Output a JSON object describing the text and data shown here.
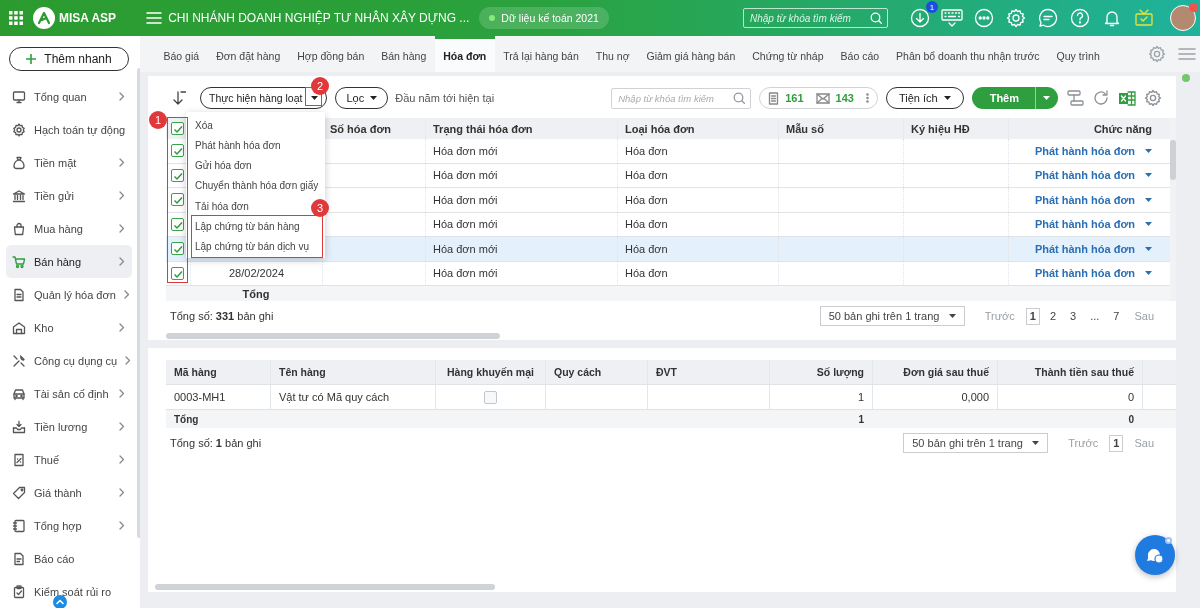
{
  "header": {
    "logo": "MISA ASP",
    "company": "CHI NHÁNH DOANH NGHIỆP TƯ NHÂN XÂY DỰNG ...",
    "dataset": "Dữ liệu kế toán 2021",
    "search_placeholder": "Nhập từ khóa tìm kiếm",
    "download_badge": "1"
  },
  "sidebar": {
    "quick_add": "Thêm nhanh",
    "items": [
      {
        "label": "Tổng quan",
        "selected": false,
        "has_submenu": true
      },
      {
        "label": "Hạch toán tự động",
        "selected": false,
        "has_submenu": false
      },
      {
        "label": "Tiền mặt",
        "selected": false,
        "has_submenu": true
      },
      {
        "label": "Tiền gửi",
        "selected": false,
        "has_submenu": true
      },
      {
        "label": "Mua hàng",
        "selected": false,
        "has_submenu": true
      },
      {
        "label": "Bán hàng",
        "selected": true,
        "has_submenu": true
      },
      {
        "label": "Quản lý hóa đơn",
        "selected": false,
        "has_submenu": true
      },
      {
        "label": "Kho",
        "selected": false,
        "has_submenu": true
      },
      {
        "label": "Công cụ dụng cụ",
        "selected": false,
        "has_submenu": true
      },
      {
        "label": "Tài sản cố định",
        "selected": false,
        "has_submenu": true
      },
      {
        "label": "Tiền lương",
        "selected": false,
        "has_submenu": true
      },
      {
        "label": "Thuế",
        "selected": false,
        "has_submenu": true
      },
      {
        "label": "Giá thành",
        "selected": false,
        "has_submenu": true
      },
      {
        "label": "Tổng hợp",
        "selected": false,
        "has_submenu": true
      },
      {
        "label": "Báo cáo",
        "selected": false,
        "has_submenu": false
      },
      {
        "label": "Kiểm soát rủi ro",
        "selected": false,
        "has_submenu": false
      }
    ]
  },
  "tabs": [
    {
      "label": "Báo giá",
      "selected": false
    },
    {
      "label": "Đơn đặt hàng",
      "selected": false
    },
    {
      "label": "Hợp đồng bán",
      "selected": false
    },
    {
      "label": "Bán hàng",
      "selected": false
    },
    {
      "label": "Hóa đơn",
      "selected": true
    },
    {
      "label": "Trả lại hàng bán",
      "selected": false
    },
    {
      "label": "Thu nợ",
      "selected": false
    },
    {
      "label": "Giảm giá hàng bán",
      "selected": false
    },
    {
      "label": "Chứng từ nháp",
      "selected": false
    },
    {
      "label": "Báo cáo",
      "selected": false
    },
    {
      "label": "Phân bổ doanh thu nhận trước",
      "selected": false
    },
    {
      "label": "Quy trình",
      "selected": false
    }
  ],
  "toolbar": {
    "batch": "Thực hiện hàng loạt",
    "filter": "Lọc",
    "period": "Đầu năm tới hiện tại",
    "search_placeholder": "Nhập từ khóa tìm kiếm",
    "invoice_count": "161",
    "email_count": "143",
    "utilities": "Tiện ích",
    "add": "Thêm"
  },
  "batch_menu": {
    "items": [
      "Xóa",
      "Phát hành hóa đơn",
      "Gửi hóa đơn",
      "Chuyển thành hóa đơn giấy",
      "Tải hóa đơn",
      "Lập chứng từ bán hàng",
      "Lập chứng từ bán dịch vụ"
    ]
  },
  "invoice_table": {
    "all_checked": true,
    "columns": [
      "Số hóa đơn",
      "Trạng thái hóa đơn",
      "Loại hóa đơn",
      "Mẫu số",
      "Ký hiệu HĐ",
      "Chức năng"
    ],
    "rows": [
      {
        "checked": true,
        "selected": false,
        "status": "Hóa đơn mới",
        "type": "Hóa đơn",
        "action": "Phát hành hóa đơn"
      },
      {
        "checked": true,
        "selected": false,
        "status": "Hóa đơn mới",
        "type": "Hóa đơn",
        "action": "Phát hành hóa đơn"
      },
      {
        "checked": true,
        "selected": false,
        "status": "Hóa đơn mới",
        "type": "Hóa đơn",
        "action": "Phát hành hóa đơn"
      },
      {
        "checked": true,
        "selected": false,
        "status": "Hóa đơn mới",
        "type": "Hóa đơn",
        "action": "Phát hành hóa đơn"
      },
      {
        "checked": true,
        "selected": true,
        "status": "Hóa đơn mới",
        "type": "Hóa đơn",
        "action": "Phát hành hóa đơn"
      },
      {
        "checked": true,
        "selected": false,
        "date": "28/02/2024",
        "status": "Hóa đơn mới",
        "type": "Hóa đơn",
        "action": "Phát hành hóa đơn"
      }
    ],
    "total_label": "Tổng"
  },
  "invoice_footer": {
    "total": "Tổng số: **331** bản ghi",
    "page_size": "50 bản ghi trên 1 trang",
    "prev": "Trước",
    "next": "Sau",
    "pages": [
      {
        "label": "1",
        "selected": true
      },
      {
        "label": "2",
        "selected": false
      },
      {
        "label": "3",
        "selected": false
      },
      {
        "label": "...",
        "selected": false
      },
      {
        "label": "7",
        "selected": false
      }
    ]
  },
  "detail_table": {
    "columns": [
      "Mã hàng",
      "Tên hàng",
      "Hàng khuyến mại",
      "Quy cách",
      "ĐVT",
      "Số lượng",
      "Đơn giá sau thuế",
      "Thành tiền sau thuế"
    ],
    "rows": [
      {
        "code": "0003-MH1",
        "name": "Vật tư có Mã quy cách",
        "promotion": false,
        "quantity": "1",
        "unit_price": "0,000",
        "amount": "0"
      }
    ],
    "totals": {
      "label": "Tổng",
      "quantity": "1",
      "amount": "0"
    }
  },
  "detail_footer": {
    "total": "Tổng số: **1** bản ghi",
    "page_size": "50 bản ghi trên 1 trang",
    "prev": "Trước",
    "next": "Sau",
    "pages": [
      {
        "label": "1",
        "selected": true
      }
    ]
  },
  "callouts": [
    "1",
    "2",
    "3"
  ]
}
